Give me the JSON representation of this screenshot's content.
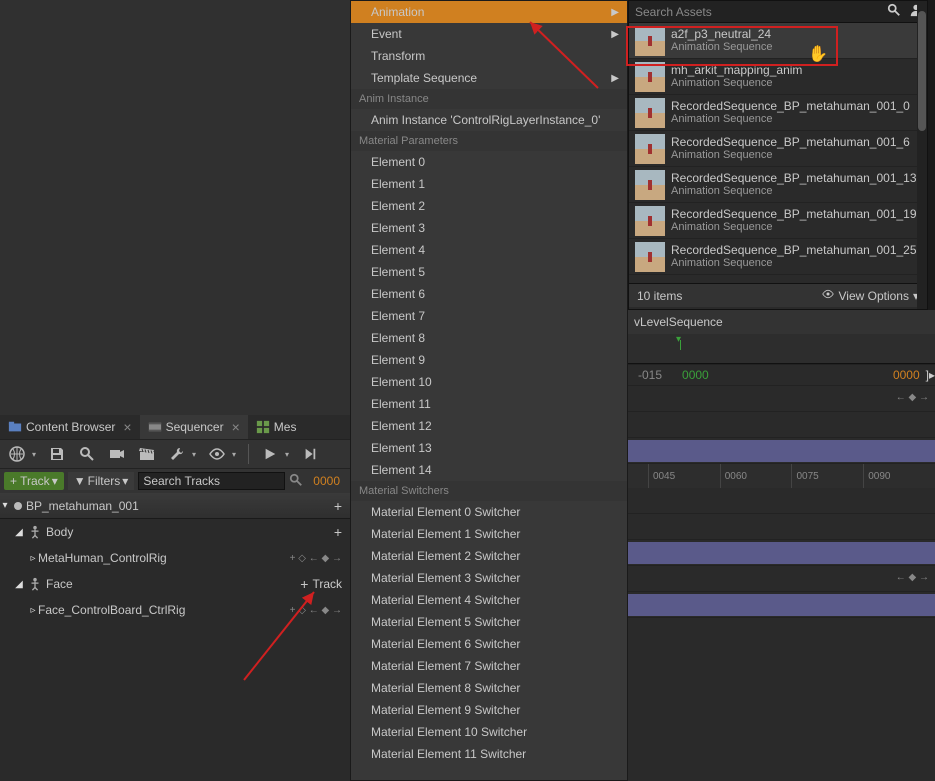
{
  "tabs": {
    "contentBrowser": "Content Browser",
    "sequencer": "Sequencer",
    "mes": "Mes"
  },
  "filterbar": {
    "trackBtn": "+ Track",
    "filtersBtn": "Filters",
    "searchPlaceholder": "Search Tracks",
    "frame": "0000"
  },
  "outliner": {
    "root": "BP_metahuman_001",
    "body": "Body",
    "metahumanRig": "MetaHuman_ControlRig",
    "face": "Face",
    "faceTrackBtn": "Track",
    "faceRig": "Face_ControlBoard_CtrlRig"
  },
  "contextmenu": {
    "items": [
      {
        "label": "Animation",
        "sub": true,
        "hl": true
      },
      {
        "label": "Event",
        "sub": true
      },
      {
        "label": "Transform"
      },
      {
        "label": "Template Sequence",
        "sub": true
      }
    ],
    "sectionAnim": "Anim Instance",
    "animInstance": "Anim Instance 'ControlRigLayerInstance_0'",
    "sectionMatParams": "Material Parameters",
    "elements": [
      "Element 0",
      "Element 1",
      "Element 2",
      "Element 3",
      "Element 4",
      "Element 5",
      "Element 6",
      "Element 7",
      "Element 8",
      "Element 9",
      "Element 10",
      "Element 11",
      "Element 12",
      "Element 13",
      "Element 14"
    ],
    "sectionMatSwitch": "Material Switchers",
    "switchers": [
      "Material Element 0 Switcher",
      "Material Element 1 Switcher",
      "Material Element 2 Switcher",
      "Material Element 3 Switcher",
      "Material Element 4 Switcher",
      "Material Element 5 Switcher",
      "Material Element 6 Switcher",
      "Material Element 7 Switcher",
      "Material Element 8 Switcher",
      "Material Element 9 Switcher",
      "Material Element 10 Switcher",
      "Material Element 11 Switcher"
    ]
  },
  "assetpicker": {
    "searchPlaceholder": "Search Assets",
    "items": [
      {
        "name": "a2f_p3_neutral_24",
        "type": "Animation Sequence"
      },
      {
        "name": "mh_arkit_mapping_anim",
        "type": "Animation Sequence"
      },
      {
        "name": "RecordedSequence_BP_metahuman_001_0",
        "type": "Animation Sequence"
      },
      {
        "name": "RecordedSequence_BP_metahuman_001_6",
        "type": "Animation Sequence"
      },
      {
        "name": "RecordedSequence_BP_metahuman_001_13",
        "type": "Animation Sequence"
      },
      {
        "name": "RecordedSequence_BP_metahuman_001_19",
        "type": "Animation Sequence"
      },
      {
        "name": "RecordedSequence_BP_metahuman_001_25",
        "type": "Animation Sequence"
      }
    ],
    "footer": "10 items",
    "viewOptions": "View Options"
  },
  "seqRight": {
    "title": "vLevelSequence",
    "neg": "-015",
    "green": "0000",
    "orange": "0000",
    "ticks": [
      "0045",
      "0060",
      "0075",
      "0090"
    ]
  }
}
